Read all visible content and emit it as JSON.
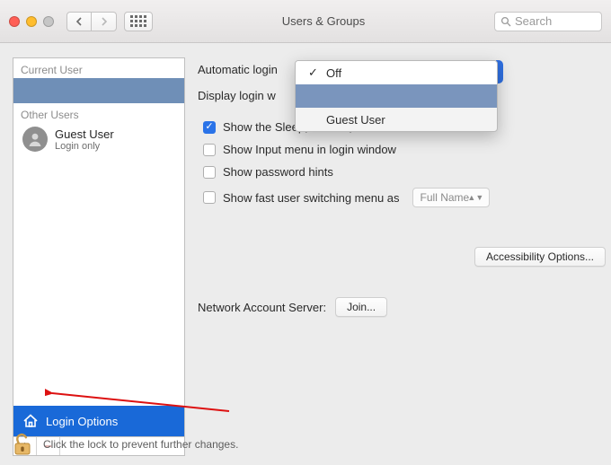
{
  "window": {
    "title": "Users & Groups",
    "search_placeholder": "Search"
  },
  "sidebar": {
    "current_label": "Current User",
    "other_label": "Other Users",
    "guest": {
      "name": "Guest User",
      "sub": "Login only"
    },
    "login_options": "Login Options"
  },
  "panel": {
    "automatic_login_label": "Automatic login",
    "display_login_label": "Display login w",
    "popup": {
      "off": "Off",
      "guest": "Guest User"
    },
    "cb_sleep": "Show the Sleep, Restart, and Shut Down buttons",
    "cb_input": "Show Input menu in login window",
    "cb_hints": "Show password hints",
    "cb_fast": "Show fast user switching menu as",
    "fast_value": "Full Name",
    "accessibility": "Accessibility Options...",
    "network_label": "Network Account Server:",
    "join": "Join..."
  },
  "footer": {
    "text": "Click the lock to prevent further changes."
  }
}
